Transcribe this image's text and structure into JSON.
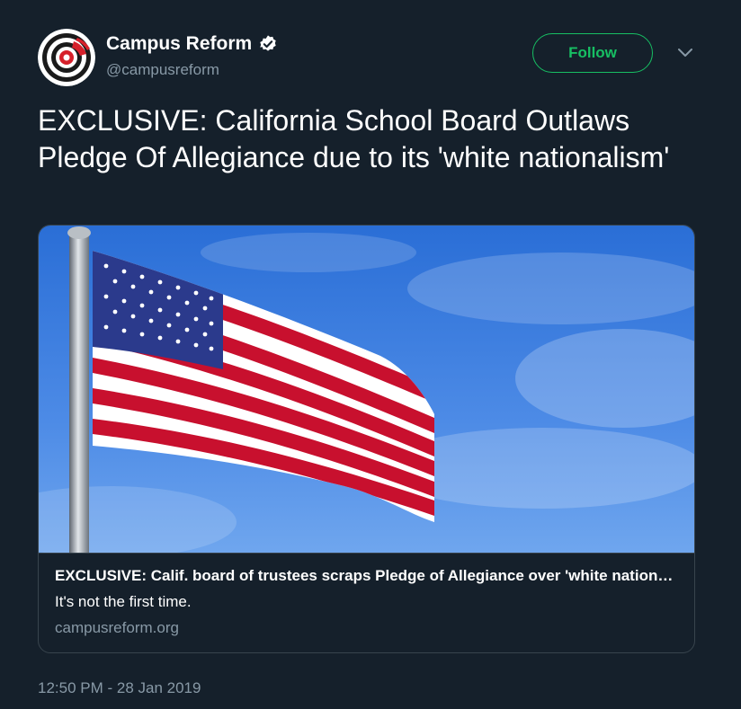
{
  "user": {
    "display_name": "Campus Reform",
    "handle": "@campusreform",
    "verified": true,
    "avatar_icon": "campus-reform-logo"
  },
  "actions": {
    "follow_label": "Follow",
    "menu_icon": "chevron-down-icon"
  },
  "tweet": {
    "text": "EXCLUSIVE: California School Board Outlaws Pledge Of Allegiance due to its 'white nationalism'",
    "timestamp": "12:50 PM - 28 Jan 2019"
  },
  "card": {
    "image_subject": "american-flag-on-pole",
    "title": "EXCLUSIVE: Calif. board of trustees scraps Pledge of Allegiance over 'white nationalism'",
    "description": "It's not the first time.",
    "domain": "campusreform.org"
  },
  "colors": {
    "background": "#15202b",
    "accent_green": "#17bf63",
    "muted_text": "#8899a6",
    "border": "#38444d"
  }
}
